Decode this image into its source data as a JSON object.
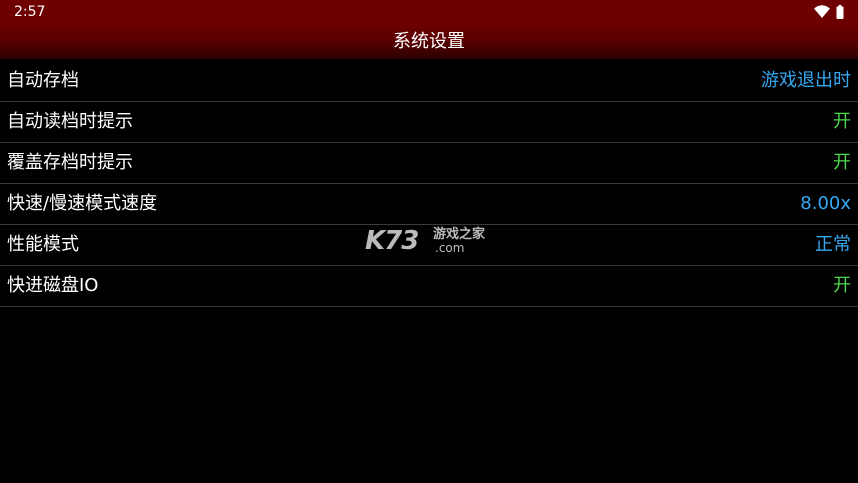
{
  "status_bar": {
    "time": "2:57",
    "icons": [
      "wifi-icon",
      "battery-icon"
    ]
  },
  "header": {
    "title": "系统设置",
    "background_color": "#6e0000"
  },
  "settings": [
    {
      "label": "自动存档",
      "value": "游戏退出时",
      "value_color": "#34a8f0"
    },
    {
      "label": "自动读档时提示",
      "value": "开",
      "value_color": "#4cd84c"
    },
    {
      "label": "覆盖存档时提示",
      "value": "开",
      "value_color": "#4cd84c"
    },
    {
      "label": "快速/慢速模式速度",
      "value": "8.00x",
      "value_color": "#34a8f0"
    },
    {
      "label": "性能模式",
      "value": "正常",
      "value_color": "#34a8f0"
    },
    {
      "label": "快进磁盘IO",
      "value": "开",
      "value_color": "#4cd84c"
    }
  ],
  "watermark": {
    "brand": "K73",
    "site_name": "游戏之家",
    "domain": ".com"
  }
}
